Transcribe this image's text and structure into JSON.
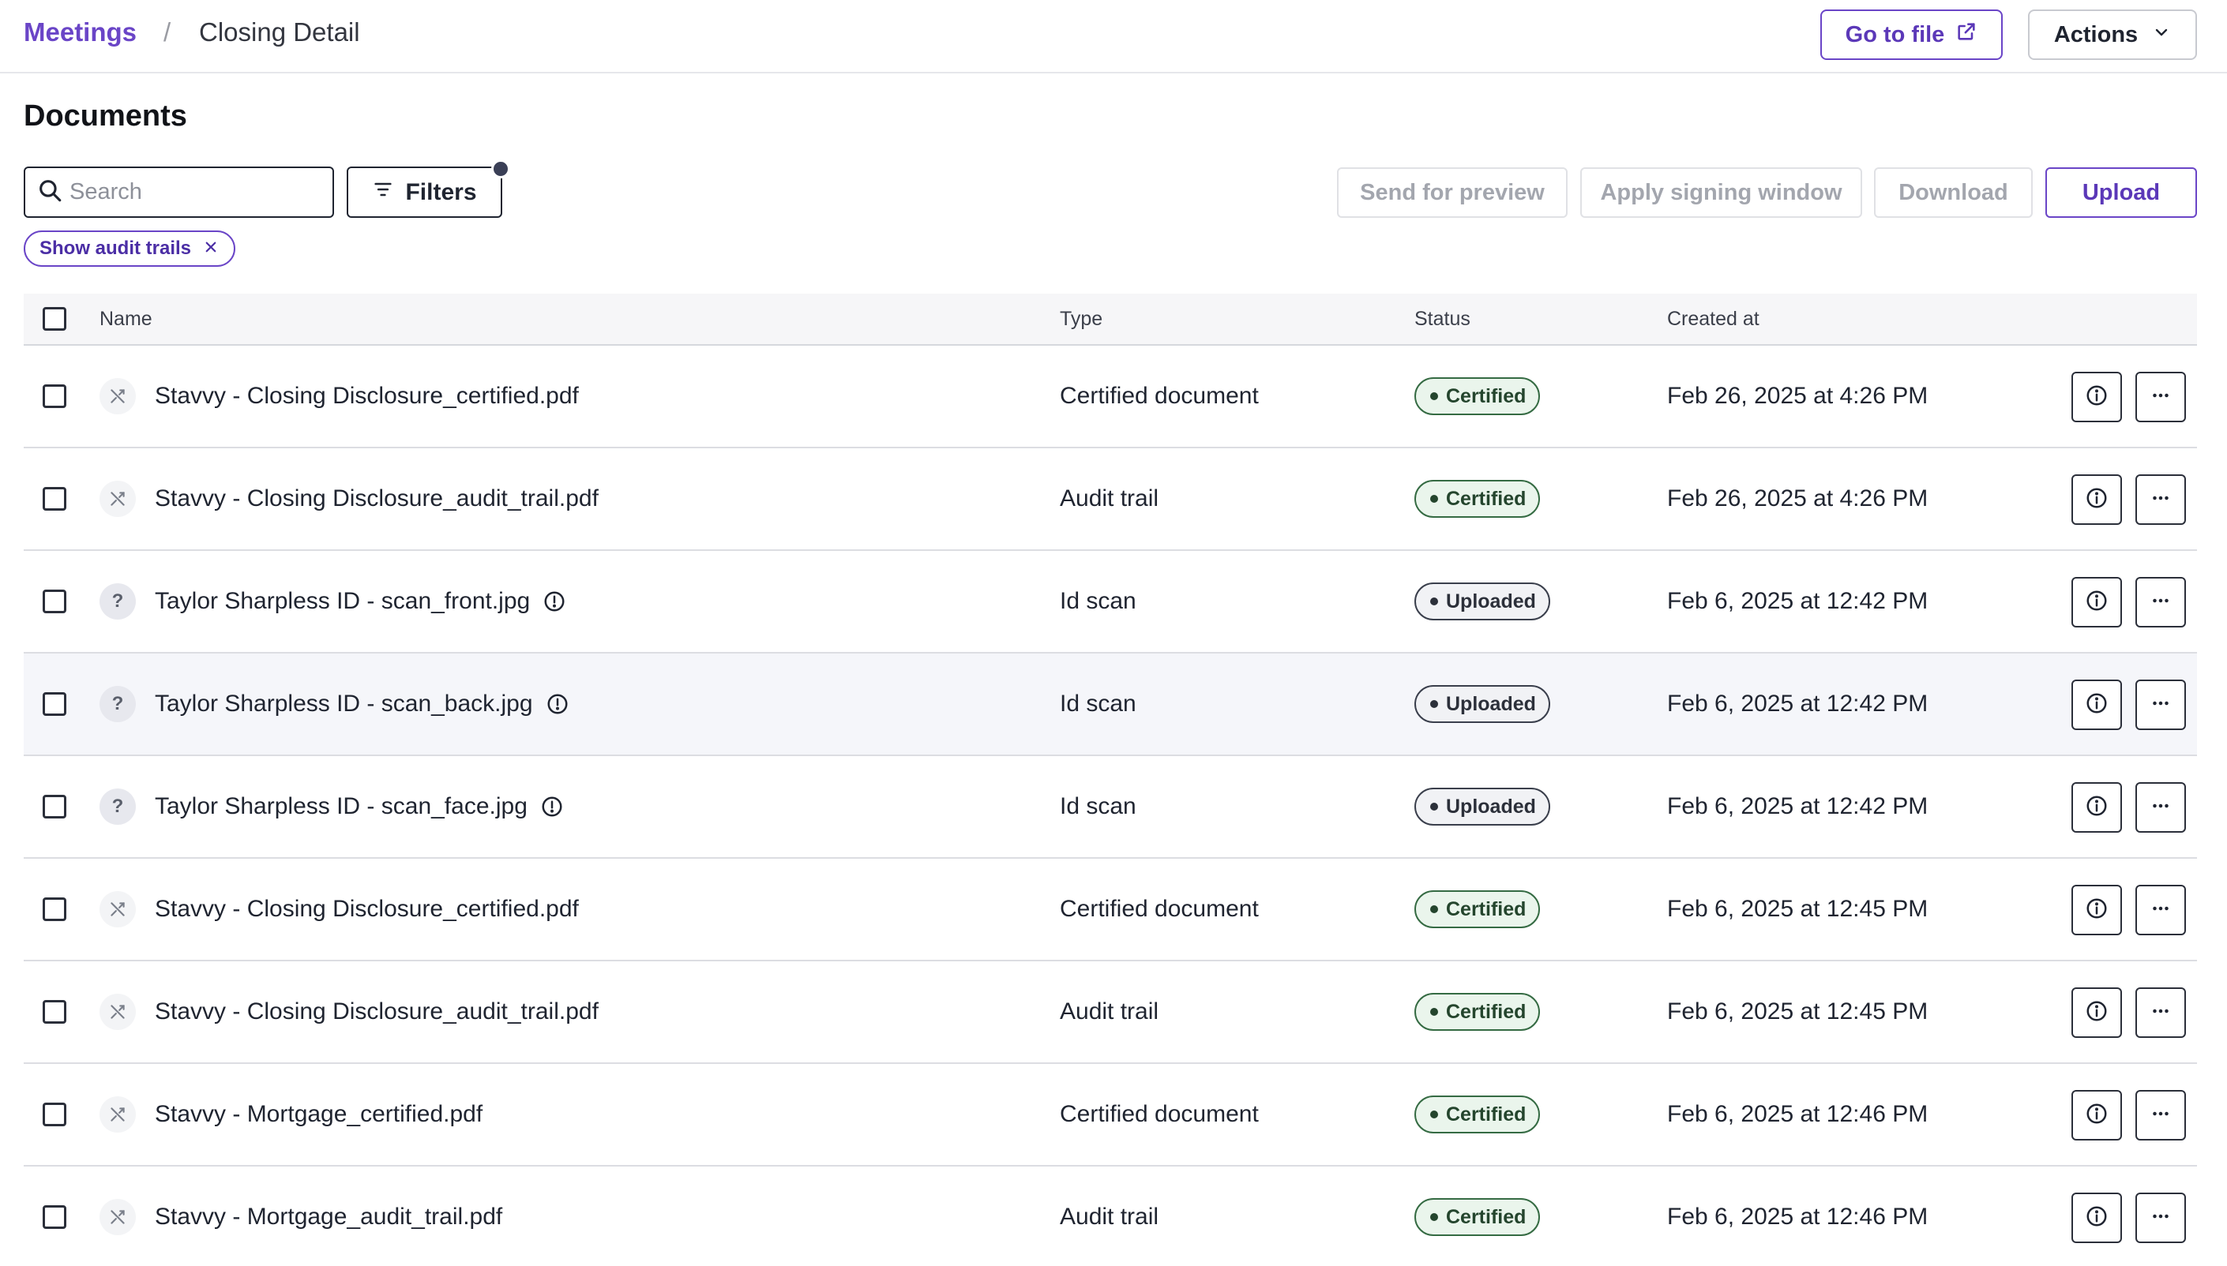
{
  "breadcrumb": {
    "parent": "Meetings",
    "separator": "/",
    "current": "Closing Detail"
  },
  "header": {
    "go_to_file": "Go to file",
    "actions": "Actions"
  },
  "section": {
    "title": "Documents"
  },
  "toolbar": {
    "search_placeholder": "Search",
    "filters": "Filters",
    "send_for_preview": "Send for preview",
    "apply_signing_window": "Apply signing window",
    "download": "Download",
    "upload": "Upload"
  },
  "chip": {
    "label": "Show audit trails"
  },
  "table": {
    "columns": {
      "name": "Name",
      "type": "Type",
      "status": "Status",
      "created_at": "Created at"
    },
    "rows": [
      {
        "icon": "no-preview-icon",
        "name": "Stavvy - Closing Disclosure_certified.pdf",
        "warning": false,
        "type": "Certified document",
        "status": "Certified",
        "created": "Feb 26, 2025 at 4:26 PM"
      },
      {
        "icon": "no-preview-icon",
        "name": "Stavvy - Closing Disclosure_audit_trail.pdf",
        "warning": false,
        "type": "Audit trail",
        "status": "Certified",
        "created": "Feb 26, 2025 at 4:26 PM"
      },
      {
        "icon": "question-icon",
        "name": "Taylor Sharpless ID - scan_front.jpg",
        "warning": true,
        "type": "Id scan",
        "status": "Uploaded",
        "created": "Feb 6, 2025 at 12:42 PM"
      },
      {
        "icon": "question-icon",
        "name": "Taylor Sharpless ID - scan_back.jpg",
        "warning": true,
        "type": "Id scan",
        "status": "Uploaded",
        "created": "Feb 6, 2025 at 12:42 PM"
      },
      {
        "icon": "question-icon",
        "name": "Taylor Sharpless ID - scan_face.jpg",
        "warning": true,
        "type": "Id scan",
        "status": "Uploaded",
        "created": "Feb 6, 2025 at 12:42 PM"
      },
      {
        "icon": "no-preview-icon",
        "name": "Stavvy - Closing Disclosure_certified.pdf",
        "warning": false,
        "type": "Certified document",
        "status": "Certified",
        "created": "Feb 6, 2025 at 12:45 PM"
      },
      {
        "icon": "no-preview-icon",
        "name": "Stavvy - Closing Disclosure_audit_trail.pdf",
        "warning": false,
        "type": "Audit trail",
        "status": "Certified",
        "created": "Feb 6, 2025 at 12:45 PM"
      },
      {
        "icon": "no-preview-icon",
        "name": "Stavvy - Mortgage_certified.pdf",
        "warning": false,
        "type": "Certified document",
        "status": "Certified",
        "created": "Feb 6, 2025 at 12:46 PM"
      },
      {
        "icon": "no-preview-icon",
        "name": "Stavvy - Mortgage_audit_trail.pdf",
        "warning": false,
        "type": "Audit trail",
        "status": "Certified",
        "created": "Feb 6, 2025 at 12:46 PM"
      }
    ]
  },
  "colors": {
    "accent": "#6a45c7",
    "certified": "#356b43",
    "uploaded": "#3a3f4c"
  }
}
